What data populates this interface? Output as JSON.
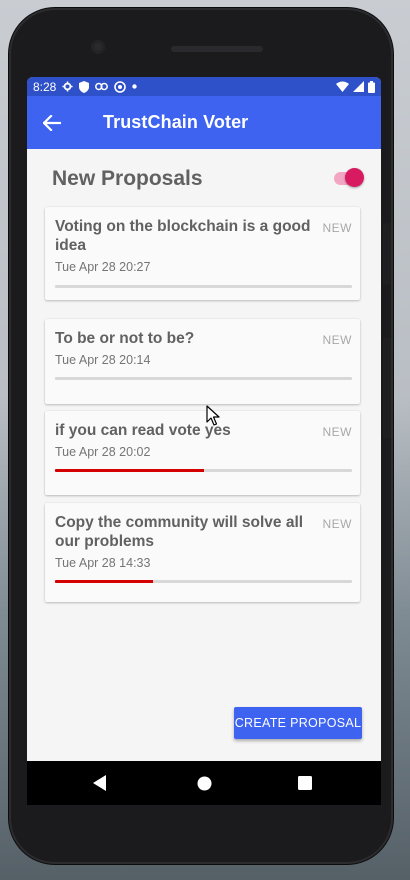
{
  "status_bar": {
    "time": "8:28",
    "icons_left": [
      "gear-icon",
      "shield-icon",
      "link-icon",
      "at-icon",
      "dot-icon"
    ],
    "icons_right": [
      "wifi-icon",
      "signal-icon",
      "battery-icon"
    ]
  },
  "app_bar": {
    "title": "TrustChain Voter",
    "back_icon": "arrow-left-icon",
    "color": "#3d63f0"
  },
  "page": {
    "title": "New Proposals",
    "toggle_on": true,
    "toggle_color": "#d81b60"
  },
  "proposals": [
    {
      "title": "Voting on the blockchain is a good idea",
      "date": "Tue Apr 28 20:27",
      "badge": "NEW",
      "progress": 0
    },
    {
      "title": "To be or not to be?",
      "date": "Tue Apr 28 20:14",
      "badge": "NEW",
      "progress": 0
    },
    {
      "title": "if you can read vote yes",
      "date": "Tue Apr 28 20:02",
      "badge": "NEW",
      "progress": 0.5
    },
    {
      "title": "Copy the community will solve all our problems",
      "date": "Tue Apr 28 14:33",
      "badge": "NEW",
      "progress": 0.33
    }
  ],
  "create_button": {
    "label": "CREATE PROPOSAL"
  },
  "nav_bar": {
    "icons": [
      "back-triangle-icon",
      "home-circle-icon",
      "recents-square-icon"
    ]
  },
  "colors": {
    "accent": "#3d63f0",
    "progress": "#d50000",
    "toggle": "#d81b60"
  }
}
